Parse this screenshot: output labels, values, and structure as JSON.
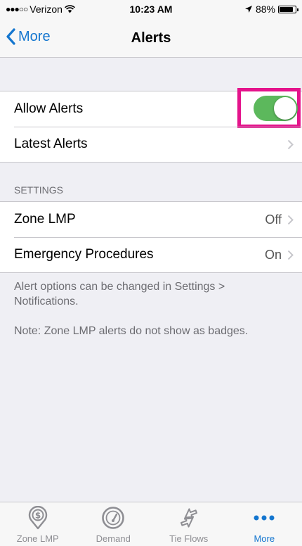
{
  "status_bar": {
    "signal": "●●●○○",
    "carrier": "Verizon",
    "time": "10:23 AM",
    "battery": "88%",
    "battery_level": 0.88
  },
  "nav": {
    "back_label": "More",
    "title": "Alerts"
  },
  "alerts_group": {
    "allow_alerts": {
      "label": "Allow Alerts",
      "enabled": true
    },
    "latest_alerts": {
      "label": "Latest Alerts"
    }
  },
  "settings": {
    "header": "SETTINGS",
    "items": [
      {
        "label": "Zone LMP",
        "value": "Off"
      },
      {
        "label": "Emergency Procedures",
        "value": "On"
      }
    ]
  },
  "footer": {
    "note1": "Alert options can be changed in Settings > Notifications.",
    "note2": "Note: Zone LMP alerts do not show as badges."
  },
  "tabs": [
    {
      "label": "Zone LMP",
      "icon": "dollar-pin-icon",
      "active": false
    },
    {
      "label": "Demand",
      "icon": "gauge-icon",
      "active": false
    },
    {
      "label": "Tie Flows",
      "icon": "tie-flows-arrows-icon",
      "active": false
    },
    {
      "label": "More",
      "icon": "more-dots-icon",
      "active": true
    }
  ],
  "colors": {
    "accent": "#1476cf",
    "toggle_on": "#5cb85c",
    "highlight": "#e4138b"
  }
}
